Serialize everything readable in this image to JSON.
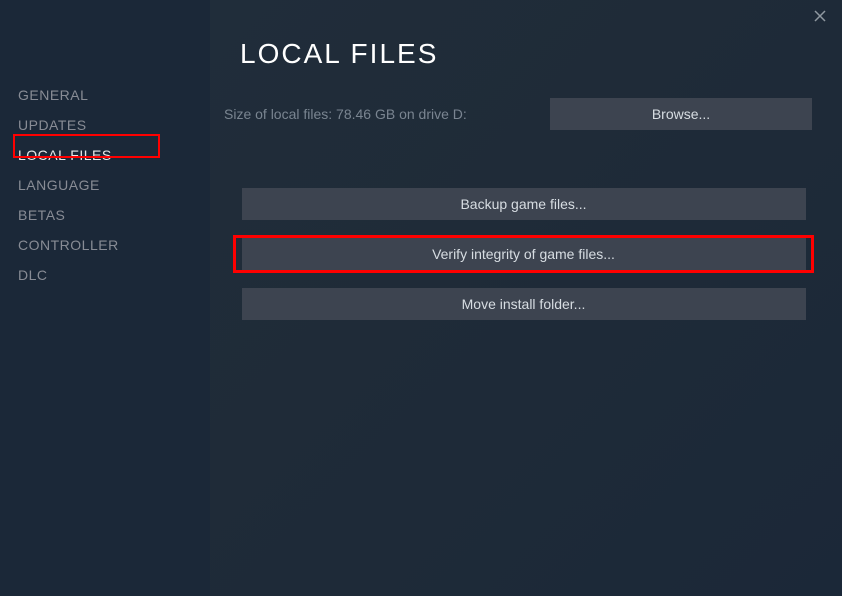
{
  "sidebar": {
    "items": [
      {
        "label": "GENERAL"
      },
      {
        "label": "UPDATES"
      },
      {
        "label": "LOCAL FILES",
        "active": true
      },
      {
        "label": "LANGUAGE"
      },
      {
        "label": "BETAS"
      },
      {
        "label": "CONTROLLER"
      },
      {
        "label": "DLC"
      }
    ]
  },
  "main": {
    "title": "LOCAL FILES",
    "size_text": "Size of local files: 78.46 GB on drive D:",
    "browse_label": "Browse...",
    "backup_label": "Backup game files...",
    "verify_label": "Verify integrity of game files...",
    "move_label": "Move install folder..."
  }
}
